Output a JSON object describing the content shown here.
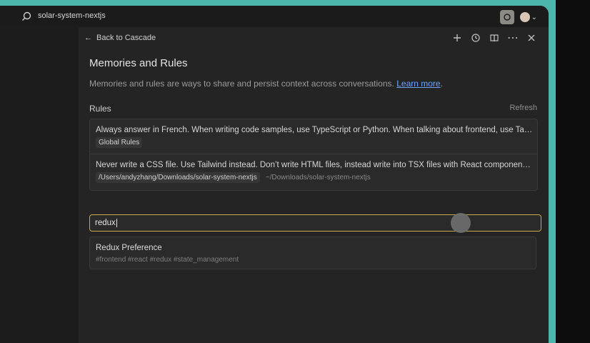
{
  "window": {
    "title": "solar-system-nextjs"
  },
  "header": {
    "back_label": "Back to Cascade"
  },
  "page": {
    "heading": "Memories and Rules",
    "subheading": "Memories and rules are ways to share and persist context across conversations.",
    "learn_more": "Learn more",
    "subheading_end": "."
  },
  "rules": {
    "label": "Rules",
    "refresh": "Refresh",
    "items": [
      {
        "text": "Always answer in French. When writing code samples, use TypeScript or Python. When talking about frontend, use Tail...",
        "badge": "Global Rules",
        "path": "",
        "short_path": ""
      },
      {
        "text": "Never write a CSS file. Use Tailwind instead. Don’t write HTML files, instead write into TSX files with React components....",
        "badge": "",
        "path": "/Users/andyzhang/Downloads/solar-system-nextjs",
        "short_path": "~/Downloads/solar-system-nextjs"
      }
    ]
  },
  "search": {
    "value": "redux"
  },
  "results": [
    {
      "title": "Redux Preference",
      "tags": "#frontend #react #redux #state_management"
    }
  ],
  "colors": {
    "accent_link": "#6ea3ff",
    "focus_border": "#c8a84a",
    "background_teal": "#4cb6ad"
  },
  "icons": [
    "search-icon",
    "app-icon",
    "avatar-icon",
    "chevron-down-icon",
    "arrow-left-icon",
    "plus-icon",
    "history-icon",
    "book-icon",
    "more-icon",
    "close-icon"
  ]
}
